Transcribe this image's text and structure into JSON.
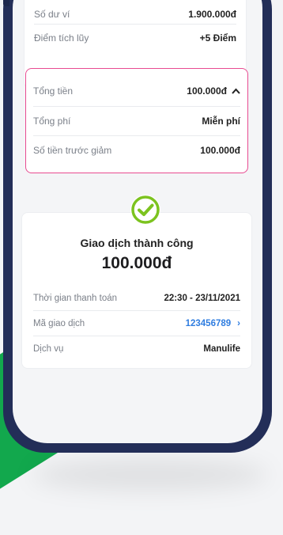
{
  "balance": {
    "balance_label": "Số dư ví",
    "balance_value": "1.900.000đ",
    "points_label": "Điểm tích lũy",
    "points_value": "+5 Điểm"
  },
  "summary": {
    "total_label": "Tổng tiền",
    "total_value": "100.000đ",
    "fee_label": "Tổng phí",
    "fee_value": "Miễn phí",
    "before_discount_label": "Số tiền trước giảm",
    "before_discount_value": "100.000đ",
    "toggle_icon": "chevron-up-icon"
  },
  "result": {
    "title": "Giao dịch thành công",
    "amount": "100.000đ",
    "time_label": "Thời gian thanh toán",
    "time_value": "22:30 - 23/11/2021",
    "code_label": "Mã giao dịch",
    "code_value": "123456789",
    "service_label": "Dịch vụ",
    "service_value": "Manulife",
    "status_icon": "check-circle-icon"
  },
  "colors": {
    "accent_pink": "#e84b91",
    "success_green": "#7cc31f",
    "link_blue": "#2f7de0",
    "phone_frame": "#232e58",
    "brand_green": "#12a84d"
  }
}
